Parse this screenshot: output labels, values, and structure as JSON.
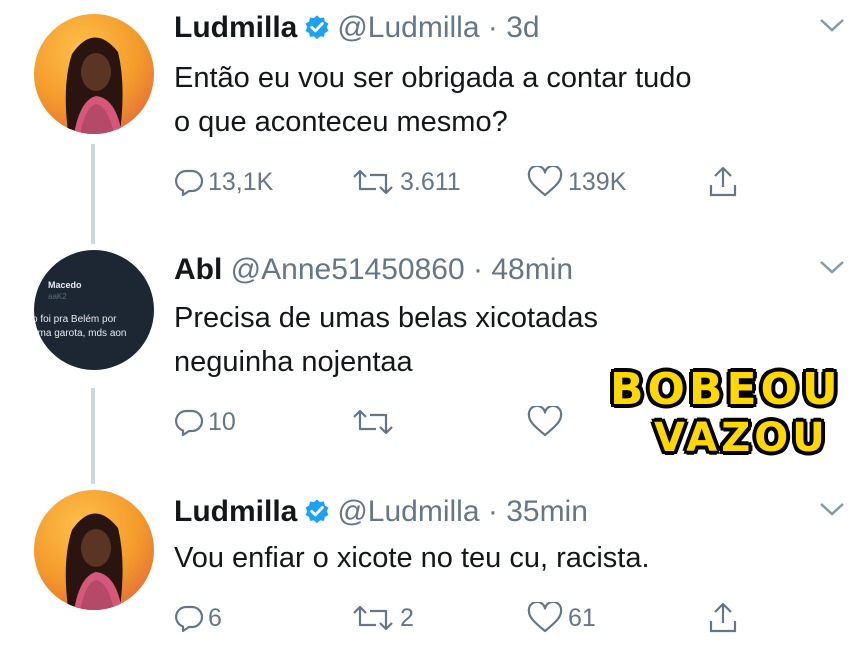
{
  "tweets": [
    {
      "name": "Ludmilla",
      "verified": true,
      "handle": "@Ludmilla",
      "time": "· 3d",
      "lines": [
        "Então eu vou ser obrigada a contar tudo",
        "o que aconteceu mesmo?"
      ],
      "replies": "13,1K",
      "retweets": "3.611",
      "likes": "139K"
    },
    {
      "name": "Abl",
      "verified": false,
      "handle": "@Anne51450860",
      "time": "· 48min",
      "lines": [
        "Precisa de umas belas xicotadas",
        "neguinha nojentaa"
      ],
      "replies": "10",
      "retweets": "",
      "likes": "",
      "avatar_text": [
        "Macedo",
        "aaK2",
        "o foi pra Belém por",
        "uma garota, mds aon"
      ]
    },
    {
      "name": "Ludmilla",
      "verified": true,
      "handle": "@Ludmilla",
      "time": "· 35min",
      "lines": [
        "Vou enfiar o xicote no teu cu, racista."
      ],
      "replies": "6",
      "retweets": "2",
      "likes": "61"
    }
  ],
  "stamp": {
    "line1": "BOBEOU",
    "line2": "VAZOU"
  },
  "icons": [
    "reply-icon",
    "retweet-icon",
    "like-icon",
    "share-icon",
    "verified-badge-icon",
    "chevron-down-icon"
  ],
  "colors": {
    "verified": "#1da1f2",
    "muted": "#657786",
    "stamp": "#ffd800"
  }
}
